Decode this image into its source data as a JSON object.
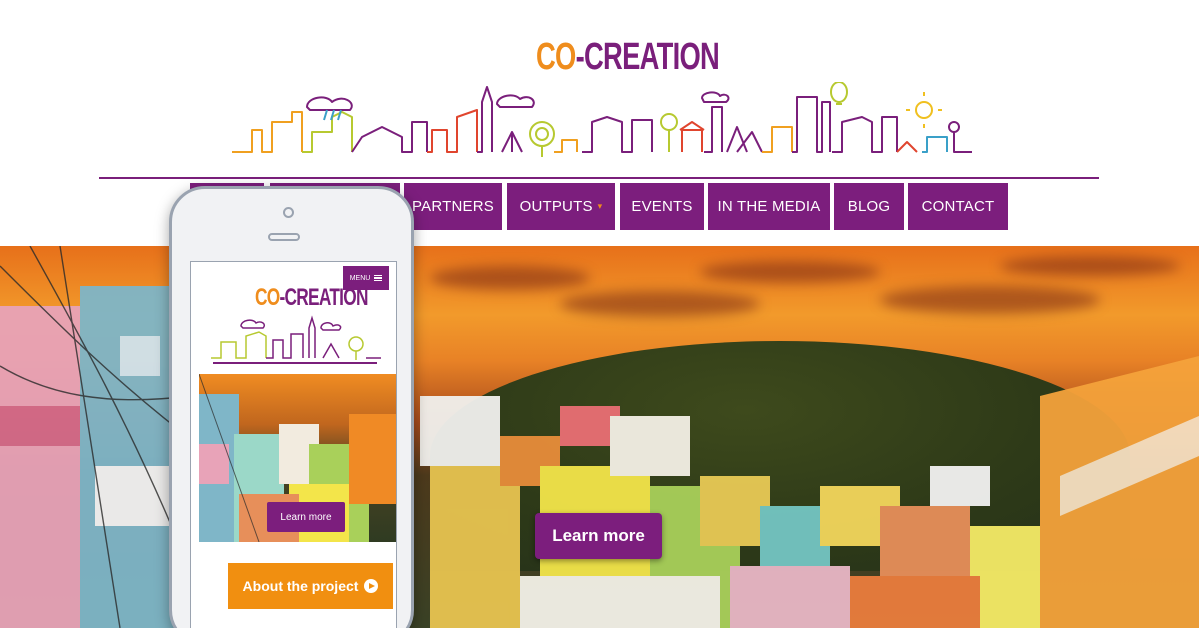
{
  "logo": {
    "co": "CO",
    "dash": "-",
    "creation": "CREATION"
  },
  "nav": {
    "items": [
      {
        "label": ""
      },
      {
        "label": ""
      },
      {
        "label": "PARTNERS"
      },
      {
        "label": "OUTPUTS"
      },
      {
        "label": "EVENTS"
      },
      {
        "label": "IN THE MEDIA"
      },
      {
        "label": "BLOG"
      },
      {
        "label": "CONTACT"
      }
    ],
    "caret": "▾"
  },
  "hero": {
    "learn_more": "Learn more"
  },
  "mobile": {
    "menu": "MENU",
    "logo": {
      "co": "CO",
      "dash": "-",
      "creation": "CREATION"
    },
    "learn_more": "Learn more",
    "about": "About the project"
  },
  "colors": {
    "purple": "#7c1e7d",
    "orange": "#ef8d1d",
    "skyline_green": "#b7c930"
  }
}
